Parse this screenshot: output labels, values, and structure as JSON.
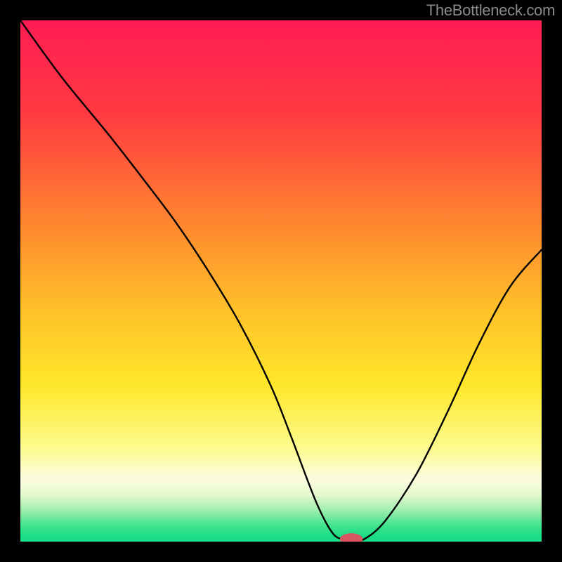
{
  "attribution": "TheBottleneck.com",
  "chart_data": {
    "type": "line",
    "title": "",
    "xlabel": "",
    "ylabel": "",
    "xlim": [
      0,
      100
    ],
    "ylim": [
      0,
      100
    ],
    "grid": false,
    "legend": false,
    "background_gradient": {
      "stops": [
        {
          "offset": 0,
          "color": "#ff1c55"
        },
        {
          "offset": 18,
          "color": "#ff3a41"
        },
        {
          "offset": 40,
          "color": "#ff8a2e"
        },
        {
          "offset": 55,
          "color": "#ffbf2a"
        },
        {
          "offset": 70,
          "color": "#ffe72a"
        },
        {
          "offset": 82,
          "color": "#fdfb8d"
        },
        {
          "offset": 88,
          "color": "#fcfce0"
        },
        {
          "offset": 91,
          "color": "#e6f9cf"
        },
        {
          "offset": 94,
          "color": "#9eeeae"
        },
        {
          "offset": 97,
          "color": "#3fe38e"
        },
        {
          "offset": 99,
          "color": "#1bdc86"
        },
        {
          "offset": 100,
          "color": "#1adc88"
        }
      ]
    },
    "series": [
      {
        "name": "bottleneck-curve",
        "color": "#000000",
        "width": 2.4,
        "x": [
          0,
          8,
          17,
          24,
          30,
          36,
          42,
          48,
          52,
          55,
          57,
          59,
          60.5,
          62,
          64,
          66,
          70,
          76,
          82,
          88,
          94,
          100
        ],
        "y": [
          100,
          89,
          78,
          69,
          61,
          52,
          42,
          30,
          20,
          12,
          7,
          3,
          1,
          0.5,
          0.5,
          0.5,
          4,
          13,
          25,
          38,
          49,
          56
        ]
      }
    ],
    "marker": {
      "name": "optimal-point",
      "x": 63.5,
      "y": 0.5,
      "rx": 2.2,
      "ry": 1.1,
      "fill": "#d7565f"
    }
  }
}
